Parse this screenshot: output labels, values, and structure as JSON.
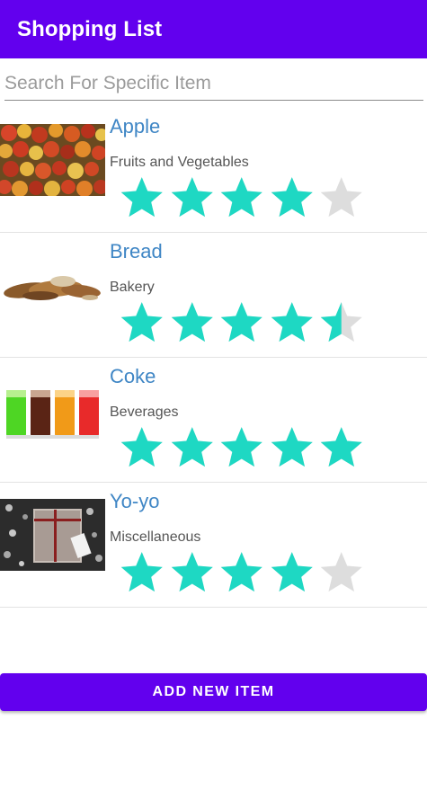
{
  "app": {
    "title": "Shopping List"
  },
  "search": {
    "placeholder": "Search For Specific Item",
    "value": ""
  },
  "items": [
    {
      "name": "Apple",
      "category": "Fruits and Vegetables",
      "rating": 4,
      "image": "apple-image"
    },
    {
      "name": "Bread",
      "category": "Bakery",
      "rating": 4.5,
      "image": "bread-image"
    },
    {
      "name": "Coke",
      "category": "Beverages",
      "rating": 5,
      "image": "coke-image"
    },
    {
      "name": "Yo-yo",
      "category": "Miscellaneous",
      "rating": 4,
      "image": "yoyo-image"
    }
  ],
  "rating_max": 5,
  "colors": {
    "primary": "#6200EE",
    "star_filled": "#1ED8C3",
    "star_empty": "#DDDDDD",
    "item_name": "#3F86C5"
  },
  "footer": {
    "add_button_label": "ADD NEW ITEM"
  }
}
